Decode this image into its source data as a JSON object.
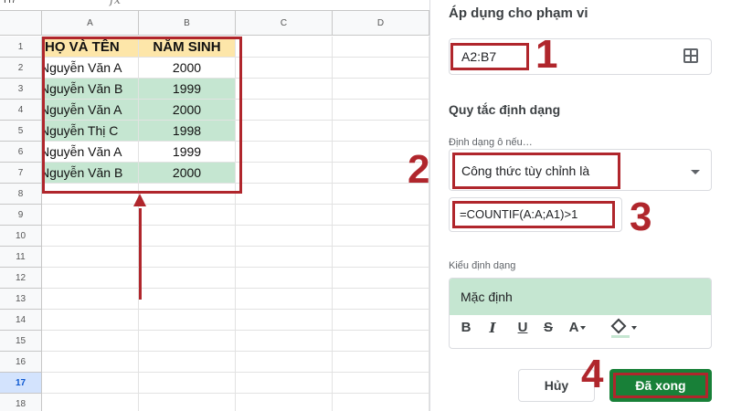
{
  "spreadsheet": {
    "namebox": "H7",
    "fx_symbol": "fx",
    "columns": [
      "A",
      "B",
      "C",
      "D"
    ],
    "rows": [
      "1",
      "2",
      "3",
      "4",
      "5",
      "6",
      "7",
      "8",
      "9",
      "10",
      "11",
      "12",
      "13",
      "14",
      "15",
      "16",
      "17",
      "18"
    ],
    "active_row": "17",
    "header": {
      "name": "HỌ VÀ TÊN",
      "year": "NĂM SINH"
    },
    "data": [
      {
        "name": "Nguyễn Văn A",
        "year": "2000",
        "highlight": false
      },
      {
        "name": "Nguyễn Văn B",
        "year": "1999",
        "highlight": true
      },
      {
        "name": "Nguyễn Văn A",
        "year": "2000",
        "highlight": true
      },
      {
        "name": "Nguyễn Thị C",
        "year": "1998",
        "highlight": true
      },
      {
        "name": "Nguyễn Văn A",
        "year": "1999",
        "highlight": false
      },
      {
        "name": "Nguyễn Văn B",
        "year": "2000",
        "highlight": true
      }
    ],
    "highlight_color": "#c5e6d1",
    "header_color": "#fde6a9"
  },
  "panel": {
    "apply_range_heading": "Áp dụng cho phạm vi",
    "range_value": "A2:B7",
    "format_rules_heading": "Quy tắc định dạng",
    "condition_label": "Định dạng ô nếu…",
    "condition_value": "Công thức tùy chỉnh là",
    "formula_value": "=COUNTIF(A:A;A1)>1",
    "style_label": "Kiểu định dạng",
    "style_preview": "Mặc định",
    "toolbar": {
      "bold": "B",
      "italic": "I",
      "underline": "U",
      "strikethrough": "S",
      "text_color": "A"
    },
    "cancel_label": "Hủy",
    "done_label": "Đã xong",
    "done_color": "#188038"
  },
  "annotations": {
    "step1": "1",
    "step2": "2",
    "step3": "3",
    "step4": "4",
    "color": "#b0262c"
  }
}
